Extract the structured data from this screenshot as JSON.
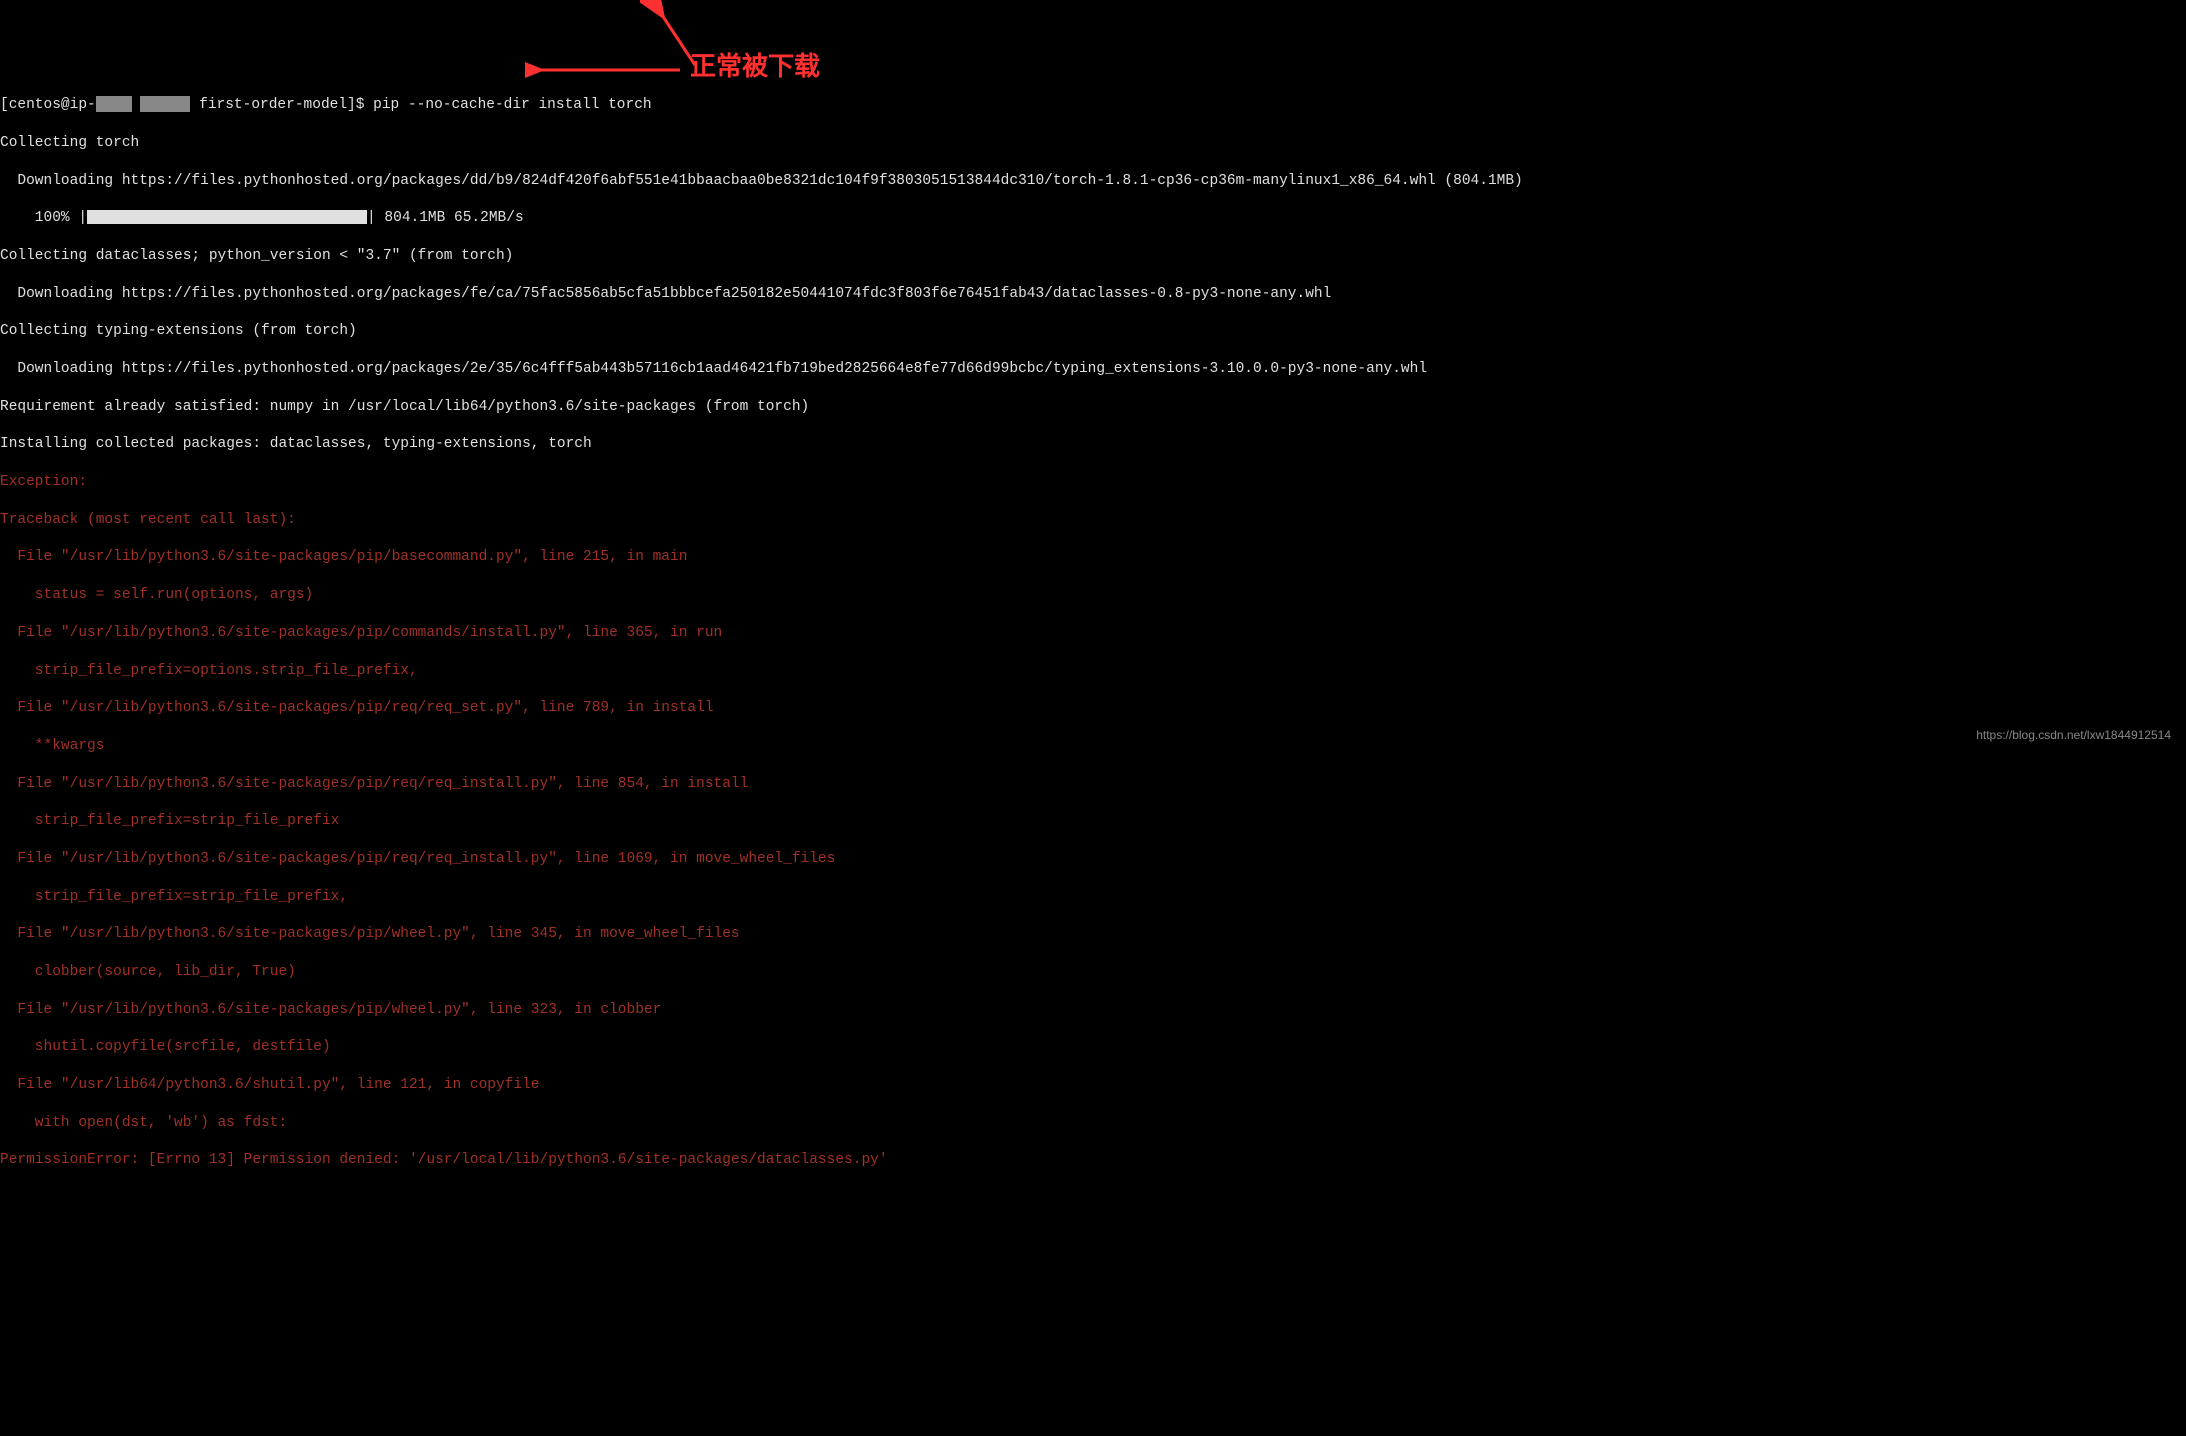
{
  "terminal": {
    "prompt_prefix": "[centos@ip-",
    "prompt_suffix": " first-order-model]$ ",
    "command": "pip --no-cache-dir install torch",
    "lines": {
      "l1": "Collecting torch",
      "l2": "  Downloading https://files.pythonhosted.org/packages/dd/b9/824df420f6abf551e41bbaacbaa0be8321dc104f9f3803051513844dc310/torch-1.8.1-cp36-cp36m-manylinux1_x86_64.whl (804.1MB)",
      "l3_pct": "    100% |",
      "l3_stats": "| 804.1MB 65.2MB/s",
      "l4": "Collecting dataclasses; python_version < \"3.7\" (from torch)",
      "l5": "  Downloading https://files.pythonhosted.org/packages/fe/ca/75fac5856ab5cfa51bbbcefa250182e50441074fdc3f803f6e76451fab43/dataclasses-0.8-py3-none-any.whl",
      "l6": "Collecting typing-extensions (from torch)",
      "l7": "  Downloading https://files.pythonhosted.org/packages/2e/35/6c4fff5ab443b57116cb1aad46421fb719bed2825664e8fe77d66d99bcbc/typing_extensions-3.10.0.0-py3-none-any.whl",
      "l8": "Requirement already satisfied: numpy in /usr/local/lib64/python3.6/site-packages (from torch)",
      "l9": "Installing collected packages: dataclasses, typing-extensions, torch"
    },
    "error": {
      "e1": "Exception:",
      "e2": "Traceback (most recent call last):",
      "e3": "  File \"/usr/lib/python3.6/site-packages/pip/basecommand.py\", line 215, in main",
      "e4": "    status = self.run(options, args)",
      "e5": "  File \"/usr/lib/python3.6/site-packages/pip/commands/install.py\", line 365, in run",
      "e6": "    strip_file_prefix=options.strip_file_prefix,",
      "e7": "  File \"/usr/lib/python3.6/site-packages/pip/req/req_set.py\", line 789, in install",
      "e8": "    **kwargs",
      "e9": "  File \"/usr/lib/python3.6/site-packages/pip/req/req_install.py\", line 854, in install",
      "e10": "    strip_file_prefix=strip_file_prefix",
      "e11": "  File \"/usr/lib/python3.6/site-packages/pip/req/req_install.py\", line 1069, in move_wheel_files",
      "e12": "    strip_file_prefix=strip_file_prefix,",
      "e13": "  File \"/usr/lib/python3.6/site-packages/pip/wheel.py\", line 345, in move_wheel_files",
      "e14": "    clobber(source, lib_dir, True)",
      "e15": "  File \"/usr/lib/python3.6/site-packages/pip/wheel.py\", line 323, in clobber",
      "e16": "    shutil.copyfile(srcfile, destfile)",
      "e17": "  File \"/usr/lib64/python3.6/shutil.py\", line 121, in copyfile",
      "e18": "    with open(dst, 'wb') as fdst:",
      "e19": "PermissionError: [Errno 13] Permission denied: '/usr/local/lib/python3.6/site-packages/dataclasses.py'"
    }
  },
  "annotation": {
    "text": "正常被下载"
  },
  "watermark": {
    "text": "https://blog.csdn.net/lxw1844912514"
  }
}
